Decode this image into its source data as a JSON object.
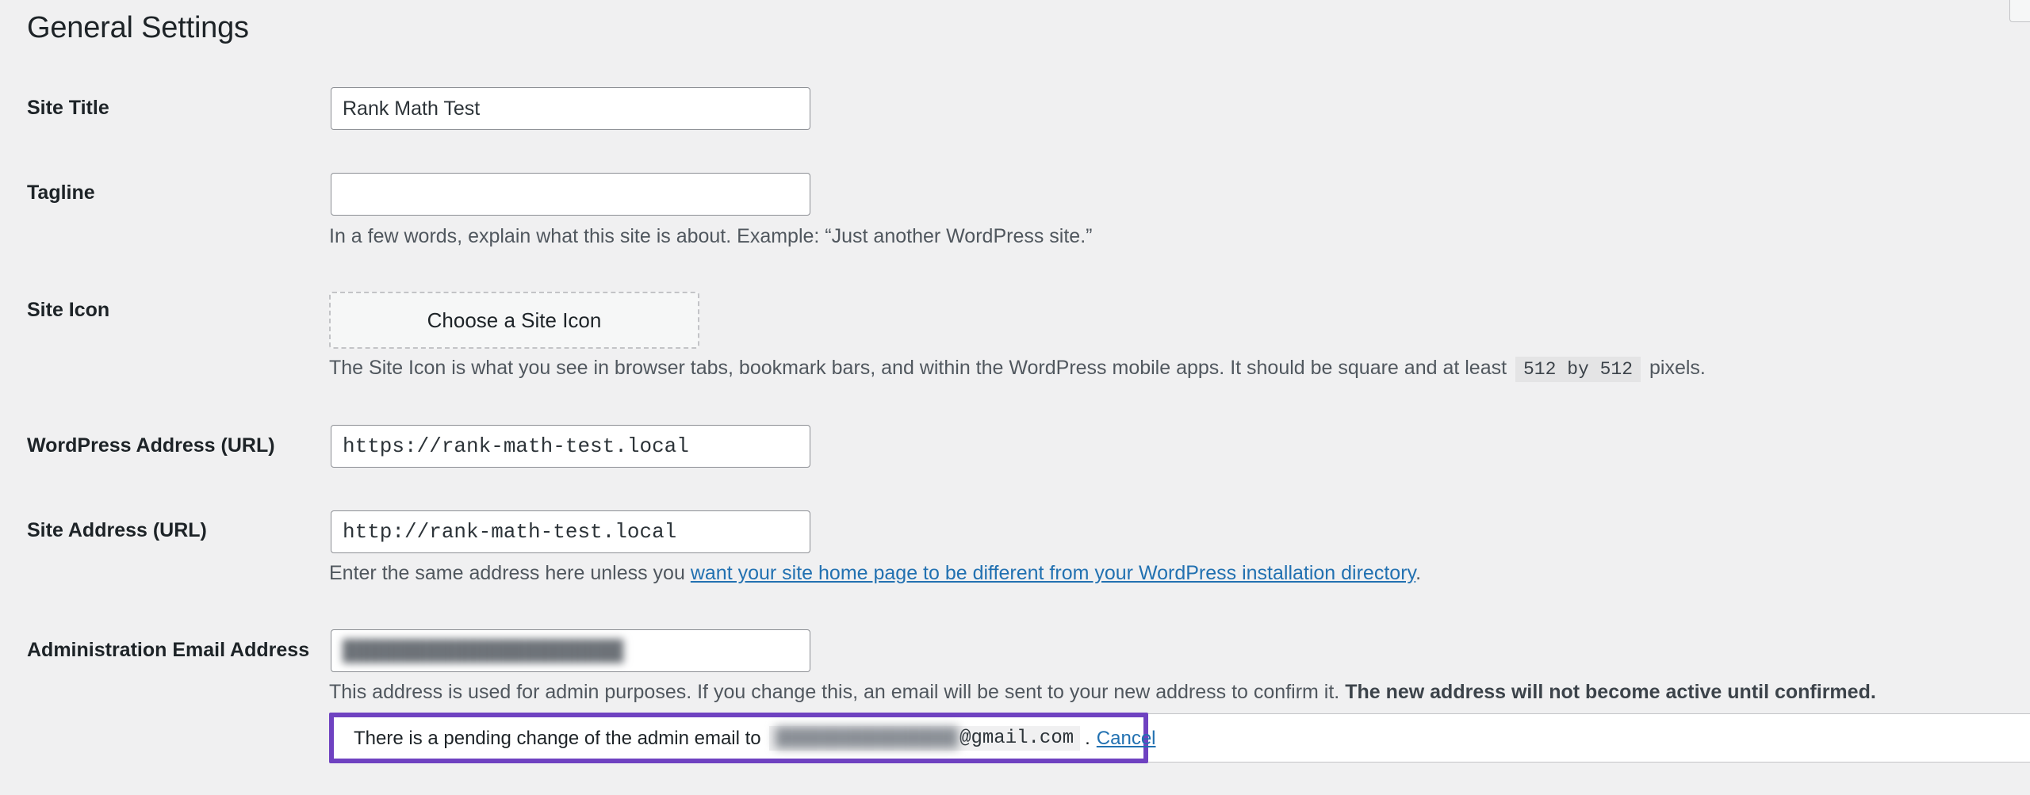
{
  "page_title": "General Settings",
  "fields": {
    "site_title": {
      "label": "Site Title",
      "value": "Rank Math Test"
    },
    "tagline": {
      "label": "Tagline",
      "value": "",
      "description": "In a few words, explain what this site is about. Example: “Just another WordPress site.”"
    },
    "site_icon": {
      "label": "Site Icon",
      "button_label": "Choose a Site Icon",
      "description_before": "The Site Icon is what you see in browser tabs, bookmark bars, and within the WordPress mobile apps. It should be square and at least",
      "code": "512 by 512",
      "description_after": "pixels."
    },
    "wordpress_address": {
      "label": "WordPress Address (URL)",
      "value": "https://rank-math-test.local"
    },
    "site_address": {
      "label": "Site Address (URL)",
      "value": "http://rank-math-test.local",
      "description_before": "Enter the same address here unless you",
      "link_text": "want your site home page to be different from your WordPress installation directory",
      "description_after": "."
    },
    "admin_email": {
      "label": "Administration Email Address",
      "value_masked": "████████████████████",
      "description": "This address is used for admin purposes. If you change this, an email will be sent to your new address to confirm it.",
      "description_bold": "The new address will not become active until confirmed."
    }
  },
  "pending_notice": {
    "text": "There is a pending change of the admin email to",
    "email_masked": "████████████████",
    "email_domain": "@gmail.com",
    "after_email": ".",
    "cancel_label": "Cancel",
    "highlight_color": "#6f42c1"
  }
}
